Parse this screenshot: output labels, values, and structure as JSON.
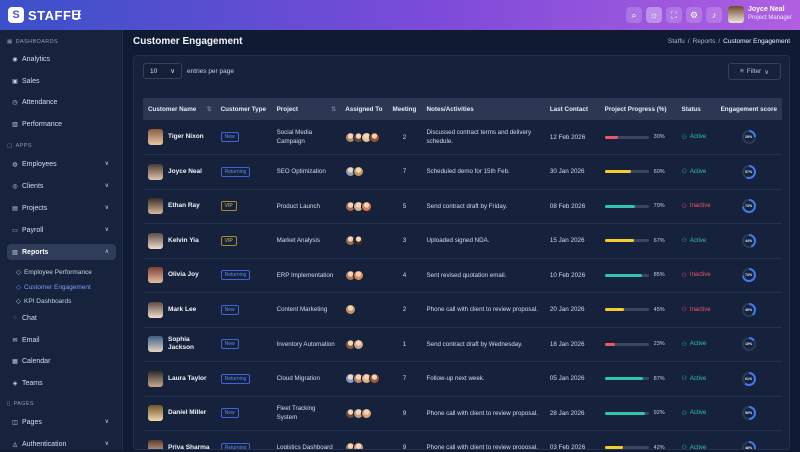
{
  "brand": {
    "name": "STAFFU"
  },
  "topbar": {
    "user_name": "Joyce Neal",
    "user_role": "Project Manager"
  },
  "sidebar": {
    "sections": {
      "dashboards": "DASHBOARDS",
      "apps": "APPS",
      "pages": "PAGES"
    },
    "items": [
      {
        "label": "Analytics"
      },
      {
        "label": "Sales"
      },
      {
        "label": "Attendance"
      },
      {
        "label": "Performance"
      },
      {
        "label": "Employees"
      },
      {
        "label": "Clients"
      },
      {
        "label": "Projects"
      },
      {
        "label": "Payroll"
      },
      {
        "label": "Reports"
      },
      {
        "label": "Chat"
      },
      {
        "label": "Email"
      },
      {
        "label": "Calendar"
      },
      {
        "label": "Teams"
      },
      {
        "label": "Pages"
      },
      {
        "label": "Authentication"
      }
    ],
    "reports_sub": [
      {
        "label": "Employee Performance"
      },
      {
        "label": "Customer Engagement"
      },
      {
        "label": "KPI Dashboards"
      }
    ]
  },
  "page": {
    "title": "Customer Engagement",
    "breadcrumb": [
      "Staffu",
      "Reports",
      "Customer Engagement"
    ]
  },
  "controls": {
    "entries_value": "10",
    "entries_label": "entries per page",
    "filter_label": "Filter"
  },
  "table": {
    "headers": [
      "Customer Name",
      "Customer Type",
      "Project",
      "Assigned To",
      "Meeting",
      "Notes/Activities",
      "Last Contact",
      "Project Progress (%)",
      "Status",
      "Engagement score"
    ],
    "rows": [
      {
        "name": "Tiger Nixon",
        "type": "New",
        "project": "Social Media Campaign",
        "meeting": "2",
        "notes": "Discussed contract terms and delivery schedule.",
        "last": "12 Feb 2026",
        "progress": 30,
        "pct": "30%",
        "status": "Active",
        "score": "25%",
        "score_val": 25,
        "bar_color": "#f0556a"
      },
      {
        "name": "Joyce Neal",
        "type": "Returning",
        "project": "SEO Optimization",
        "meeting": "7",
        "notes": "Scheduled demo for 15th Feb.",
        "last": "30 Jan 2026",
        "progress": 60,
        "pct": "60%",
        "status": "Active",
        "score": "57%",
        "score_val": 57,
        "bar_color": "#f5cc2e"
      },
      {
        "name": "Ethan Ray",
        "type": "VIP",
        "project": "Product Launch",
        "meeting": "5",
        "notes": "Send contract draft by Friday.",
        "last": "08 Feb 2026",
        "progress": 70,
        "pct": "70%",
        "status": "Inactive",
        "score": "73%",
        "score_val": 73,
        "bar_color": "#2fc2b5"
      },
      {
        "name": "Kelvin Yia",
        "type": "VIP",
        "project": "Market Analysis",
        "meeting": "3",
        "notes": "Uploaded signed NDA.",
        "last": "15 Jan 2026",
        "progress": 67,
        "pct": "67%",
        "status": "Active",
        "score": "44%",
        "score_val": 44,
        "bar_color": "#f5cc2e"
      },
      {
        "name": "Olivia Joy",
        "type": "Returning",
        "project": "ERP Implementation",
        "meeting": "4",
        "notes": "Sent revised quotation email.",
        "last": "10 Feb 2026",
        "progress": 85,
        "pct": "85%",
        "status": "Inactive",
        "score": "73%",
        "score_val": 73,
        "bar_color": "#2fc2b5"
      },
      {
        "name": "Mark Lee",
        "type": "New",
        "project": "Content Marketing",
        "meeting": "2",
        "notes": "Phone call with client to review proposal.",
        "last": "20 Jan 2026",
        "progress": 45,
        "pct": "45%",
        "status": "Inactive",
        "score": "40%",
        "score_val": 40,
        "bar_color": "#f5cc2e"
      },
      {
        "name": "Sophia Jackson",
        "type": "New",
        "project": "Inventory Automation",
        "meeting": "1",
        "notes": "Send contract draft by Wednesday.",
        "last": "18 Jan 2026",
        "progress": 23,
        "pct": "23%",
        "status": "Active",
        "score": "15%",
        "score_val": 15,
        "bar_color": "#f0556a"
      },
      {
        "name": "Laura Taylor",
        "type": "Returning",
        "project": "Cloud Migration",
        "meeting": "7",
        "notes": "Follow-up next week.",
        "last": "05 Jan 2026",
        "progress": 87,
        "pct": "87%",
        "status": "Active",
        "score": "61%",
        "score_val": 61,
        "bar_color": "#2fc2b5"
      },
      {
        "name": "Daniel Miller",
        "type": "New",
        "project": "Fleet Tracking System",
        "meeting": "9",
        "notes": "Phone call with client to review proposal.",
        "last": "28 Jan 2026",
        "progress": 92,
        "pct": "92%",
        "status": "Active",
        "score": "50%",
        "score_val": 50,
        "bar_color": "#2fc2b5"
      },
      {
        "name": "Priya Sharma",
        "type": "Returning",
        "project": "Logistics Dashboard",
        "meeting": "9",
        "notes": "Phone call with client to review proposal.",
        "last": "03 Feb 2026",
        "progress": 42,
        "pct": "42%",
        "status": "Active",
        "score": "48%",
        "score_val": 48,
        "bar_color": "#f5cc2e"
      }
    ]
  }
}
